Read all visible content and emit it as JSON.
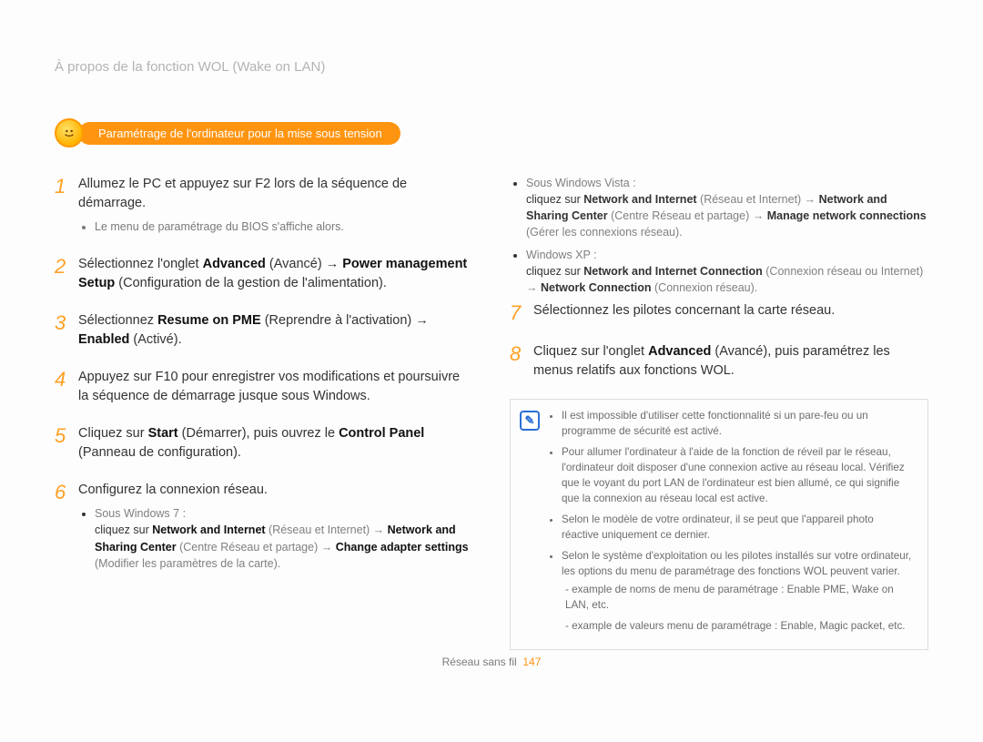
{
  "breadcrumb": "À propos de la fonction WOL (Wake on LAN)",
  "pill": {
    "icon": "smiley-icon",
    "label": "Paramétrage de l'ordinateur pour la mise sous tension"
  },
  "left": {
    "s1": {
      "num": "1",
      "text": "Allumez le PC et appuyez sur F2 lors de la séquence de démarrage.",
      "sub_bullet": "Le menu de paramétrage du BIOS s'affiche alors."
    },
    "s2": {
      "num": "2",
      "part1": "Sélectionnez l'onglet ",
      "b1": "Advanced",
      "paren1": " (Avancé) → ",
      "b2": "Power management Setup",
      "paren2": " (Configuration de la gestion de l'alimentation)."
    },
    "s3": {
      "num": "3",
      "part1": "Sélectionnez ",
      "b1": "Resume on PME",
      "paren1": " (Reprendre à l'activation) → ",
      "b2": "Enabled",
      "paren2": " (Activé)."
    },
    "s4": {
      "num": "4",
      "text": "Appuyez sur F10 pour enregistrer vos modifications et poursuivre la séquence de démarrage jusque sous Windows."
    },
    "s5": {
      "num": "5",
      "part1": "Cliquez sur ",
      "b1": "Start",
      "paren1": " (Démarrer), puis ouvrez le ",
      "b2": "Control Panel",
      "paren2": " (Panneau de configuration)."
    },
    "s6": {
      "num": "6",
      "text": "Configurez la connexion réseau.",
      "win7_label": "Sous Windows 7 :",
      "win7_line_a": "cliquez sur ",
      "win7_b1": "Network and Internet",
      "win7_p1": " (Réseau et Internet) → ",
      "win7_b2": "Network and Sharing Center",
      "win7_p2": " (Centre Réseau et partage) → ",
      "win7_b3": "Change adapter settings",
      "win7_p3": " (Modifier les paramètres de la carte)."
    }
  },
  "right": {
    "vista_label": "Sous Windows Vista :",
    "vista_a": "cliquez sur ",
    "vista_b1": "Network and Internet",
    "vista_p1": " (Réseau et Internet) → ",
    "vista_b2": "Network and Sharing Center",
    "vista_p2": " (Centre Réseau et partage) → ",
    "vista_b3": "Manage network connections",
    "vista_p3": " (Gérer les connexions réseau).",
    "xp_label": "Windows XP :",
    "xp_a": "cliquez sur ",
    "xp_b1": "Network and Internet Connection",
    "xp_p1": " (Connexion réseau ou Internet) → ",
    "xp_b2": "Network Connection",
    "xp_p2": " (Connexion réseau).",
    "s7": {
      "num": "7",
      "text": "Sélectionnez les pilotes concernant la carte réseau."
    },
    "s8": {
      "num": "8",
      "part1": "Cliquez sur l'onglet ",
      "b1": "Advanced",
      "paren1": " (Avancé), puis paramétrez les menus relatifs aux fonctions WOL."
    },
    "note": {
      "icon": "pencil-note-icon",
      "n1": "Il est impossible d'utiliser cette fonctionnalité si un pare-feu ou un programme de sécurité est activé.",
      "n2": "Pour allumer l'ordinateur à l'aide de la fonction de réveil par le réseau, l'ordinateur doit disposer d'une connexion active au réseau local. Vérifiez que le voyant du port LAN de l'ordinateur est bien allumé, ce qui signifie que la connexion au réseau local est active.",
      "n3": "Selon le modèle de votre ordinateur, il se peut que l'appareil photo réactive uniquement ce dernier.",
      "n4": "Selon le système d'exploitation ou les pilotes installés sur votre ordinateur, les options du menu de paramétrage des fonctions WOL peuvent varier.",
      "n4a": "example de noms de menu de paramétrage : Enable PME, Wake on LAN, etc.",
      "n4b": "example de valeurs menu de paramétrage : Enable, Magic packet, etc."
    }
  },
  "footer": {
    "label": "Réseau sans fil",
    "page": "147"
  }
}
